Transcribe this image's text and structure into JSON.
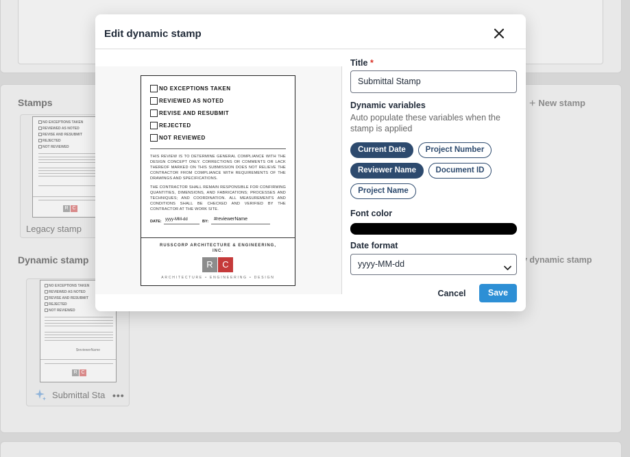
{
  "background": {
    "stamps_section_title": "Stamps",
    "new_stamp_label": "New stamp",
    "new_stamp_icon": "plus-icon",
    "legacy_stamp_label": "Legacy stamp",
    "dynamic_section_title": "Dynamic stamp",
    "new_dynamic_label": "y dynamic stamp",
    "dynamic_card_label": "Submittal Sta",
    "dynamic_card_icon": "sparkle-icon",
    "dynamic_card_menu_icon": "more-horizontal-icon",
    "mini_checks": [
      "NO EXCEPTIONS TAKEN",
      "REVIEWED AS NOTED",
      "REVISE AND RESUBMIT",
      "REJECTED",
      "NOT REVIEWED"
    ],
    "mini_reviewer": "$reviewerName",
    "mini_logo_r": "R",
    "mini_logo_c": "C"
  },
  "modal": {
    "title": "Edit dynamic stamp",
    "close_icon": "close-icon",
    "stamp_preview": {
      "checks": [
        "NO EXCEPTIONS TAKEN",
        "REVIEWED AS NOTED",
        "REVISE AND RESUBMIT",
        "REJECTED",
        "NOT REVIEWED"
      ],
      "paragraph1": "THIS REVIEW IS TO DETERMINE GENERAL COMPLIANCE WITH THE DESIGN CONCEPT ONLY. CORRECTIONS OR COMMENTS OR LACK THEREOF MARKED ON THIS SUBMISSION DOES NOT RELIEVE THE CONTRACTOR FROM COMPLIANCE WITH REQUIREMENTS OF THE DRAWINGS AND SPECIFICATIONS.",
      "paragraph2": "THE CONTRACTOR SHALL REMAIN RESPONSIBLE FOR CONFIRMING QUANTITIES, DIMENSIONS, AND FABRICATIONS; PROCESSES AND TECHNIQUES; AND COORDINATION. ALL MEASUREMENTS AND CONDITIONS SHALL BE CHECKED AND VERIFIED BY THE CONTRACTOR AT THE WORK SITE.",
      "date_label": "DATE:",
      "date_value": "yyyy-MM-dd",
      "by_label": "BY:",
      "by_value": "#reviewerName",
      "company_line1": "RUSSCORP ARCHITECTURE & ENGINEERING,",
      "company_line2": "INC.",
      "logo_r": "R",
      "logo_c": "C",
      "tagline": "ARCHITECTURE • ENGINEERING • DESIGN"
    },
    "title_field": {
      "label": "Title",
      "required_marker": "*",
      "value": "Submittal Stamp"
    },
    "dynamic_variables": {
      "label": "Dynamic variables",
      "helper": "Auto populate these variables when the stamp is applied",
      "chips": [
        {
          "label": "Current Date",
          "active": true
        },
        {
          "label": "Project Number",
          "active": false
        },
        {
          "label": "Reviewer Name",
          "active": true
        },
        {
          "label": "Document ID",
          "active": false
        },
        {
          "label": "Project Name",
          "active": false
        }
      ]
    },
    "font_color": {
      "label": "Font color",
      "value": "#000000"
    },
    "date_format": {
      "label": "Date format",
      "value": "yyyy-MM-dd",
      "caret_icon": "chevron-down-icon"
    },
    "cancel_label": "Cancel",
    "save_label": "Save"
  }
}
